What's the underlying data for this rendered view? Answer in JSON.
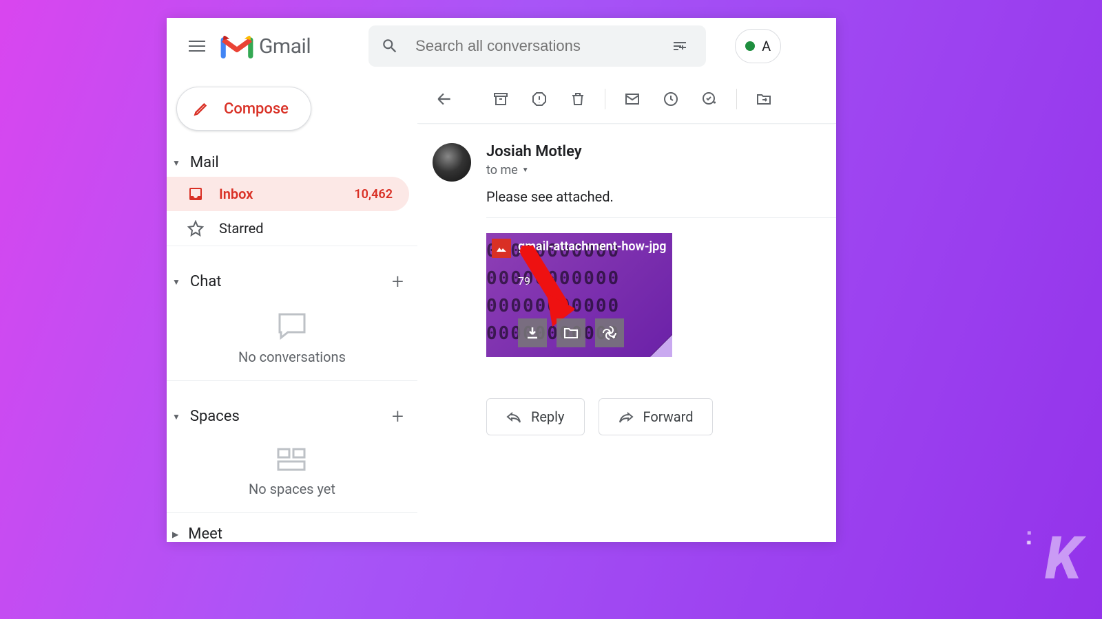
{
  "app": {
    "name": "Gmail"
  },
  "header": {
    "search_placeholder": "Search all conversations",
    "status_label": "A"
  },
  "sidebar": {
    "compose_label": "Compose",
    "sections": {
      "mail": {
        "label": "Mail"
      },
      "chat": {
        "label": "Chat",
        "empty_text": "No conversations"
      },
      "spaces": {
        "label": "Spaces",
        "empty_text": "No spaces yet"
      },
      "meet": {
        "label": "Meet"
      }
    },
    "nav": {
      "inbox": {
        "label": "Inbox",
        "count": "10,462"
      },
      "starred": {
        "label": "Starred"
      }
    }
  },
  "message": {
    "sender_name": "Josiah Motley",
    "recipient_line": "to me",
    "body_text": "Please see attached.",
    "attachment": {
      "filename": "gmail-attachment-how-jpg",
      "size_hint": "79"
    },
    "actions": {
      "reply": "Reply",
      "forward": "Forward"
    }
  },
  "icons": {
    "menu": "menu-icon",
    "search": "search-icon",
    "tune": "tune-icon",
    "back": "back-arrow-icon",
    "archive": "archive-icon",
    "spam": "report-spam-icon",
    "delete": "delete-icon",
    "unread": "mark-unread-icon",
    "snooze": "snooze-icon",
    "task": "add-task-icon",
    "move": "move-to-icon"
  }
}
